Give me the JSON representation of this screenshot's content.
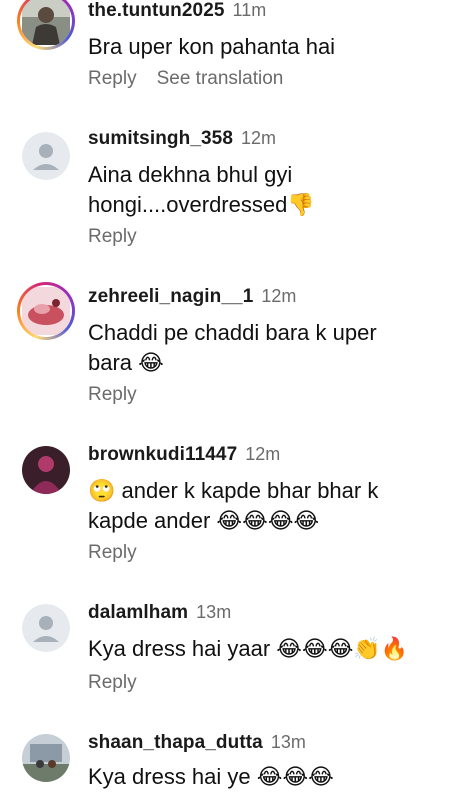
{
  "comments": [
    {
      "username": "the.tuntun2025",
      "time": "11m",
      "text": "Bra uper kon pahanta hai",
      "reply_label": "Reply",
      "translation_label": "See translation",
      "avatar_icon": "profile-photo-icon"
    },
    {
      "username": "sumitsingh_358",
      "time": "12m",
      "text_line1": "Aina dekhna bhul gyi",
      "text_line2": "hongi....overdressed👎",
      "reply_label": "Reply",
      "avatar_icon": "default-avatar-icon"
    },
    {
      "username": "zehreeli_nagin__1",
      "time": "12m",
      "text_line1": "Chaddi pe chaddi bara k uper",
      "text_line2": "bara 😂",
      "reply_label": "Reply",
      "avatar_icon": "profile-photo-icon"
    },
    {
      "username": "brownkudi11447",
      "time": "12m",
      "text_line1": "🙄 ander k kapde bhar  bhar k",
      "text_line2": "kapde ander 😂😂😂😂",
      "reply_label": "Reply",
      "avatar_icon": "profile-photo-icon"
    },
    {
      "username": "dalamlham",
      "time": "13m",
      "text": "Kya dress hai yaar 😂😂😂👏🔥",
      "reply_label": "Reply",
      "avatar_icon": "default-avatar-icon"
    },
    {
      "username": "shaan_thapa_dutta",
      "time": "13m",
      "text": "Kya dress hai ye 😂😂😂",
      "avatar_icon": "profile-photo-icon"
    }
  ],
  "colors": {
    "username": "#1a1a1a",
    "secondary": "#6b6b6b",
    "story_ring_start": "#fa7e1e",
    "story_ring_end": "#d62976",
    "default_avatar_bg": "#e6e9ed",
    "default_avatar_fg": "#a8b0ba"
  }
}
